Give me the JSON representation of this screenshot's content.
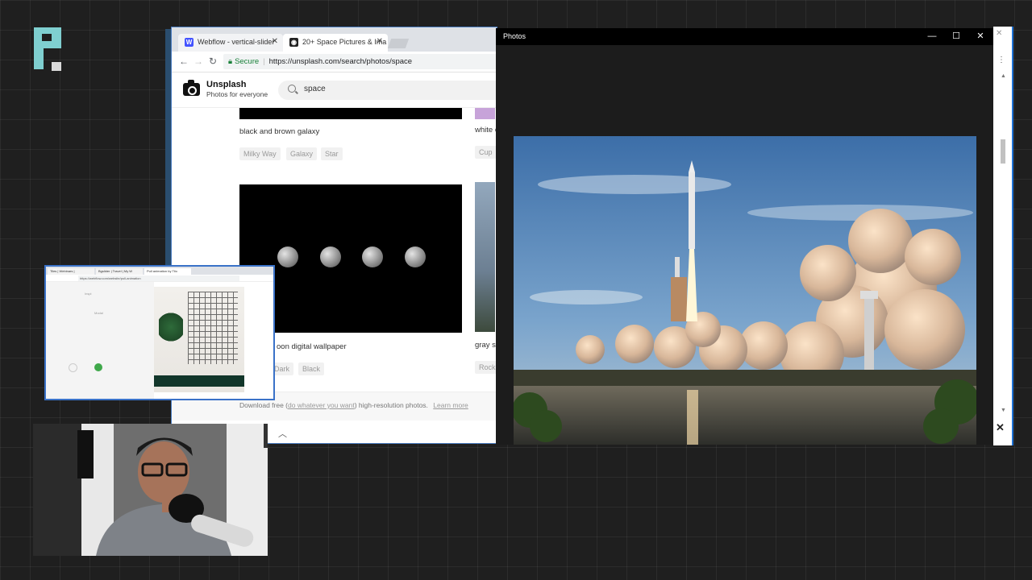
{
  "chrome": {
    "tabs": [
      {
        "label": "Webflow - vertical-slider",
        "icon": "webflow-icon"
      },
      {
        "label": "20+ Space Pictures & Ima",
        "icon": "camera-icon"
      }
    ],
    "address": {
      "secure_label": "Secure",
      "url": "https://unsplash.com/search/photos/space"
    }
  },
  "unsplash": {
    "brand_name": "Unsplash",
    "brand_tagline": "Photos for everyone",
    "search_value": "space",
    "results": [
      {
        "caption": "black and brown galaxy",
        "tags": [
          "Milky Way",
          "Galaxy",
          "Star"
        ]
      },
      {
        "caption": "oon digital wallpaper",
        "tags": [
          "Dark",
          "Black"
        ]
      }
    ],
    "side_results": [
      {
        "caption": "white c",
        "tags": [
          "Cup"
        ]
      },
      {
        "caption": "gray s",
        "tags": [
          "Rock"
        ]
      }
    ],
    "footer": {
      "prefix": "Download free (",
      "link": "do whatever you want",
      "suffix": ") high-resolution photos.",
      "learn_more": "Learn more"
    }
  },
  "photos_app": {
    "title": "Photos",
    "minimize": "—",
    "maximize": "☐",
    "close": "✕"
  },
  "chrome_right": {
    "close": "✕",
    "menu": "⋮",
    "panel_close": "✕",
    "scroll_up": "▲",
    "scroll_down": "▼"
  },
  "mini_browser": {
    "tabs": [
      "Tiles | Webinars |",
      "Bgslider | Travel | My W",
      "Pull animation by Tilo"
    ],
    "url": "https://webflow.com/website/pull-animation",
    "labels": [
      "Inspi",
      "Modal"
    ]
  }
}
